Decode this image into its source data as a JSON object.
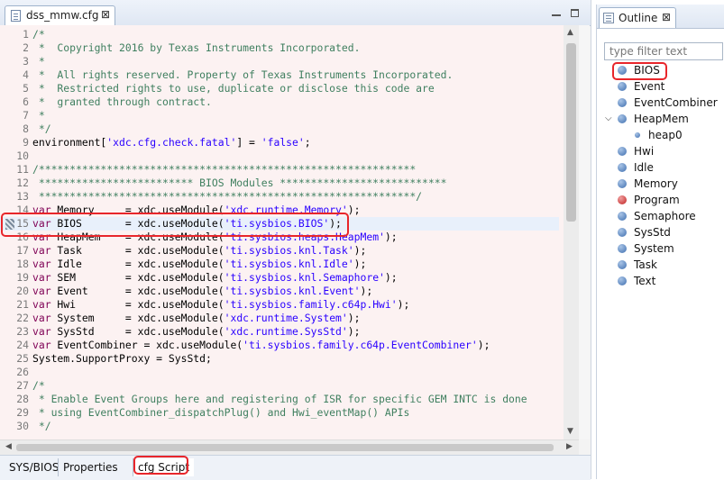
{
  "editor": {
    "tab_title": "dss_mmw.cfg",
    "tab_close": "⊠",
    "lines": [
      {
        "n": "1",
        "t": "/*",
        "type": "comment"
      },
      {
        "n": "2",
        "t": " *  Copyright 2016 by Texas Instruments Incorporated.",
        "type": "comment"
      },
      {
        "n": "3",
        "t": " *",
        "type": "comment"
      },
      {
        "n": "4",
        "t": " *  All rights reserved. Property of Texas Instruments Incorporated.",
        "type": "comment"
      },
      {
        "n": "5",
        "t": " *  Restricted rights to use, duplicate or disclose this code are",
        "type": "comment"
      },
      {
        "n": "6",
        "t": " *  granted through contract.",
        "type": "comment"
      },
      {
        "n": "7",
        "t": " *",
        "type": "comment"
      },
      {
        "n": "8",
        "t": " */",
        "type": "comment"
      },
      {
        "n": "9",
        "pre": "environment[",
        "str": "'xdc.cfg.check.fatal'",
        "post": "] = ",
        "str2": "'false'",
        "post2": ";",
        "type": "mixed"
      },
      {
        "n": "10",
        "t": "",
        "type": "plain"
      },
      {
        "n": "11",
        "t": "/*************************************************************",
        "type": "comment"
      },
      {
        "n": "12",
        "t": " ************************* BIOS Modules ***************************",
        "type": "comment"
      },
      {
        "n": "13",
        "t": " *************************************************************/",
        "type": "comment"
      },
      {
        "n": "14",
        "kw": "var",
        "pre": " Memory     = xdc.useModule(",
        "str": "'xdc.runtime.Memory'",
        "post": ");",
        "type": "var"
      },
      {
        "n": "15",
        "kw": "var",
        "pre": " BIOS       = xdc.useModule(",
        "str": "'ti.sysbios.BIOS'",
        "post": ");",
        "type": "var"
      },
      {
        "n": "16",
        "kw": "var",
        "pre": " HeapMem    = xdc.useModule(",
        "str": "'ti.sysbios.heaps.HeapMem'",
        "post": ");",
        "type": "var"
      },
      {
        "n": "17",
        "kw": "var",
        "pre": " Task       = xdc.useModule(",
        "str": "'ti.sysbios.knl.Task'",
        "post": ");",
        "type": "var"
      },
      {
        "n": "18",
        "kw": "var",
        "pre": " Idle       = xdc.useModule(",
        "str": "'ti.sysbios.knl.Idle'",
        "post": ");",
        "type": "var"
      },
      {
        "n": "19",
        "kw": "var",
        "pre": " SEM        = xdc.useModule(",
        "str": "'ti.sysbios.knl.Semaphore'",
        "post": ");",
        "type": "var"
      },
      {
        "n": "20",
        "kw": "var",
        "pre": " Event      = xdc.useModule(",
        "str": "'ti.sysbios.knl.Event'",
        "post": ");",
        "type": "var"
      },
      {
        "n": "21",
        "kw": "var",
        "pre": " Hwi        = xdc.useModule(",
        "str": "'ti.sysbios.family.c64p.Hwi'",
        "post": ");",
        "type": "var"
      },
      {
        "n": "22",
        "kw": "var",
        "pre": " System     = xdc.useModule(",
        "str": "'xdc.runtime.System'",
        "post": ");",
        "type": "var"
      },
      {
        "n": "23",
        "kw": "var",
        "pre": " SysStd     = xdc.useModule(",
        "str": "'xdc.runtime.SysStd'",
        "post": ");",
        "type": "var"
      },
      {
        "n": "24",
        "kw": "var",
        "pre": " EventCombiner = xdc.useModule(",
        "str": "'ti.sysbios.family.c64p.EventCombiner'",
        "post": ");",
        "type": "var"
      },
      {
        "n": "25",
        "t": "System.SupportProxy = SysStd;",
        "type": "plain"
      },
      {
        "n": "26",
        "t": "",
        "type": "plain"
      },
      {
        "n": "27",
        "t": "/*",
        "type": "comment"
      },
      {
        "n": "28",
        "t": " * Enable Event Groups here and registering of ISR for specific GEM INTC is done",
        "type": "comment"
      },
      {
        "n": "29",
        "t": " * using EventCombiner_dispatchPlug() and Hwi_eventMap() APIs",
        "type": "comment"
      },
      {
        "n": "30",
        "t": " */",
        "type": "comment"
      }
    ],
    "highlighted_line": "15"
  },
  "bottom_tabs": [
    "SYS/BIOS",
    "Properties",
    "cfg Script"
  ],
  "active_bottom_tab": "cfg Script",
  "outline": {
    "tab_title": "Outline",
    "tab_close": "⊠",
    "filter_placeholder": "type filter text",
    "items": [
      {
        "label": "BIOS",
        "level": 0,
        "icon": "module-dot-blue-icon"
      },
      {
        "label": "Event",
        "level": 0,
        "icon": "module-dot-blue-icon"
      },
      {
        "label": "EventCombiner",
        "level": 0,
        "icon": "module-dot-blue-icon"
      },
      {
        "label": "HeapMem",
        "level": 0,
        "icon": "module-dot-blue-icon",
        "expanded": true
      },
      {
        "label": "heap0",
        "level": 1,
        "icon": "instance-dot-icon"
      },
      {
        "label": "Hwi",
        "level": 0,
        "icon": "module-dot-blue-icon"
      },
      {
        "label": "Idle",
        "level": 0,
        "icon": "module-dot-blue-icon"
      },
      {
        "label": "Memory",
        "level": 0,
        "icon": "module-dot-blue-icon"
      },
      {
        "label": "Program",
        "level": 0,
        "icon": "module-dot-red-icon"
      },
      {
        "label": "Semaphore",
        "level": 0,
        "icon": "module-dot-blue-icon"
      },
      {
        "label": "SysStd",
        "level": 0,
        "icon": "module-dot-blue-icon"
      },
      {
        "label": "System",
        "level": 0,
        "icon": "module-dot-blue-icon"
      },
      {
        "label": "Task",
        "level": 0,
        "icon": "module-dot-blue-icon"
      },
      {
        "label": "Text",
        "level": 0,
        "icon": "module-dot-blue-icon"
      }
    ]
  },
  "colors": {
    "comment": "#3f7f5f",
    "string": "#2a00ff",
    "keyword": "#7f0055",
    "highlight_box": "#e8262b",
    "editor_bg": "#fcf2f2"
  }
}
